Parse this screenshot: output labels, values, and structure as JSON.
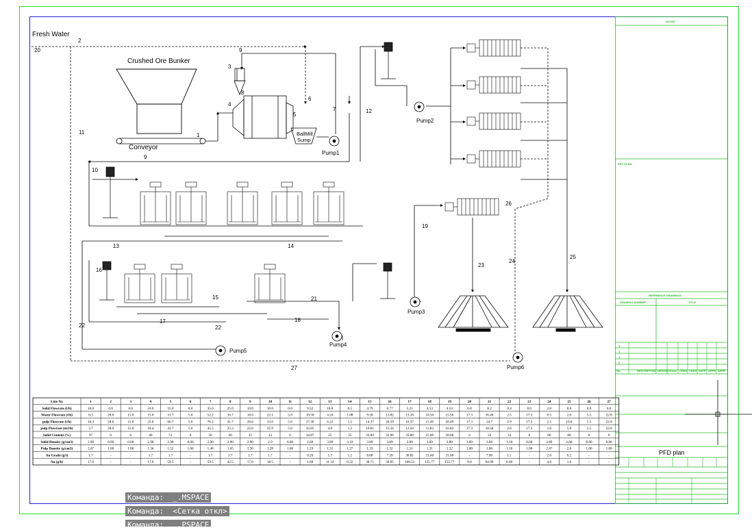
{
  "colors": {
    "outer_frame": "#22dd22",
    "drawing_frame": "#2222cc",
    "title_block": "#22bb22",
    "lines": "#000000"
  },
  "labels": {
    "fresh_water": "Fresh Water",
    "crushed_ore_bunker": "Crushed Ore Bunker",
    "conveyor": "Conveyor",
    "ball_mill_sump_1": "BallMill",
    "ball_mill_sump_2": "Sump",
    "pump1": "Pump1",
    "pump2": "Pump2",
    "pump3": "Pump3",
    "pump4": "Pump4",
    "pump5": "Pump5",
    "pump6": "Pump6"
  },
  "stream_numbers": [
    "1",
    "2",
    "3",
    "4",
    "5",
    "6",
    "7",
    "8",
    "9",
    "9",
    "10",
    "11",
    "12",
    "13",
    "14",
    "15",
    "16",
    "17",
    "18",
    "19",
    "20",
    "21",
    "22",
    "22",
    "23",
    "24",
    "25",
    "26",
    "27"
  ],
  "title_block": {
    "notes": "NOTES",
    "key_plan": "KEY PLAN:",
    "reference_drawings": "REFERENCE DRAWINGS",
    "drawing_number": "DRAWING NUMBER",
    "title_col": "TITLE",
    "rev_numbers": [
      "3",
      "2",
      "1",
      "0"
    ],
    "rev_header": [
      "No.",
      "DESCRIPTION",
      "DESIGN",
      "Drawn",
      "CHKD",
      "CHKD",
      "DATE",
      "APPR",
      "APPR"
    ],
    "drawing_title": "PFD plan"
  },
  "table": {
    "header": [
      "Line No",
      "1",
      "2",
      "3",
      "4",
      "5",
      "6",
      "7",
      "8",
      "9",
      "10",
      "11",
      "12",
      "13",
      "14",
      "15",
      "16",
      "17",
      "18",
      "19",
      "20",
      "21",
      "22",
      "23",
      "24",
      "25",
      "26",
      "27"
    ],
    "rows": [
      [
        "Solid Flowrate (t/h)",
        "10.0",
        "0.0",
        "0.0",
        "10.0",
        "35.0",
        "0.0",
        "35.0",
        "25.0",
        "10.0",
        "10.0",
        "0.0",
        "9.52",
        "10.8",
        "0.5",
        "4.79",
        "6.77",
        "5.21",
        "4.53",
        "4.53",
        "0.0",
        "8.2",
        "0.4",
        "0.0",
        "2.0",
        "8.0",
        "0.0",
        "0.0"
      ],
      [
        "Water Flowrate (t/h)",
        "0.3",
        "28.6",
        "15.0",
        "15.0",
        "31.7",
        "5.6",
        "52.2",
        "16.7",
        "18.6",
        "22.1",
        "5.0",
        "19.50",
        "4.24",
        "1.08",
        "9.58",
        "13.82",
        "13.16",
        "10.56",
        "15.56",
        "17.3",
        "16.46",
        "2.5",
        "17.3",
        "0.5",
        "2.0",
        "5.5",
        "22.8"
      ],
      [
        "pulp Flowrate (t/h)",
        "10.3",
        "28.6",
        "15.0",
        "25.0",
        "66.7",
        "5.6",
        "76.2",
        "41.7",
        "28.6",
        "33.0",
        "5.0",
        "27.30",
        "6.22",
        "1.5",
        "14.37",
        "20.59",
        "16.37",
        "15.49",
        "20.49",
        "17.3",
        "24.7",
        "2.9",
        "17.3",
        "2.5",
        "10.0",
        "5.5",
        "22.8"
      ],
      [
        "pulp Flowrate (m3/h)",
        "3.7",
        "28.6",
        "15.0",
        "18.4",
        "43.7",
        "5.6",
        "45.5",
        "25.3",
        "22.0",
        "25.9",
        "5.0",
        "22.85",
        "4.8",
        "1.2",
        "10.81",
        "15.56",
        "12.50",
        "11.83",
        "16.83",
        "17.3",
        "18.58",
        "2.6",
        "17.3",
        "1.0",
        "5.0",
        "5.5",
        "22.8"
      ],
      [
        "Solid Content (%)",
        "97",
        "0",
        "0",
        "40",
        "51",
        "0",
        "50",
        "60",
        "35",
        "33",
        "0",
        "34.87",
        "25",
        "25",
        "33.00",
        "32.86",
        "25.00",
        "25.00",
        "20.06",
        "0",
        "33",
        "14",
        "0",
        "80",
        "80",
        "0",
        "0"
      ],
      [
        "Solid Density (g/cm3)",
        "2.90",
        "0.00",
        "0.00",
        "2.90",
        "2.90",
        "0.00",
        "2.90",
        "2.90",
        "2.90",
        "2.9",
        "0.00",
        "2.68",
        "3.89",
        "3.10",
        "3.89",
        "3.89",
        "3.89",
        "3.89",
        "3.89",
        "3.89",
        "3.89",
        "3.10",
        "0.00",
        "3.89",
        "2.68",
        "0.00",
        "0.00"
      ],
      [
        "Pulp Density (g/cm3)",
        "2.67",
        "1.00",
        "1.00",
        "1.36",
        "1.52",
        "1.00",
        "1.48",
        "1.65",
        "1.30",
        "1.28",
        "1.00",
        "1.19",
        "1.31",
        "1.27",
        "1.33",
        "1.32",
        "1.31",
        "1.31",
        "1.22",
        "1.00",
        "1.00",
        "1.10",
        "1.00",
        "2.47",
        "2.0",
        "1.00",
        "1.00"
      ],
      [
        "Au Grade (g/t)",
        "1.7",
        "-",
        "-",
        "1.7",
        "1.7",
        "-",
        "1.7",
        "1.7",
        "1.7",
        "1.7",
        "-",
        "0.20",
        "5.7",
        "1.2",
        "8.08",
        "7.39",
        "30.81",
        "31.60",
        "31.60",
        "-",
        "7.90",
        "1.1",
        "-",
        "2.0",
        "0.2",
        "-",
        "-"
      ],
      [
        "Au (g/h)",
        "17.0",
        "-",
        "-",
        "17.0",
        "59.5",
        "-",
        "59.5",
        "42.5",
        "17.0",
        "18.5",
        "-",
        "1.60",
        "11.32",
        "0.55",
        "38.71",
        "50.05",
        "160.51",
        "155.77",
        "155.77",
        "0.0",
        "64.96",
        "0.40",
        "-",
        "4.0",
        "1.6",
        "-",
        "-"
      ]
    ]
  },
  "commands": [
    "Команда:  _.MSPACE",
    "Команда:  <Сетка откл>",
    "Команда:  _.PSPACE"
  ]
}
